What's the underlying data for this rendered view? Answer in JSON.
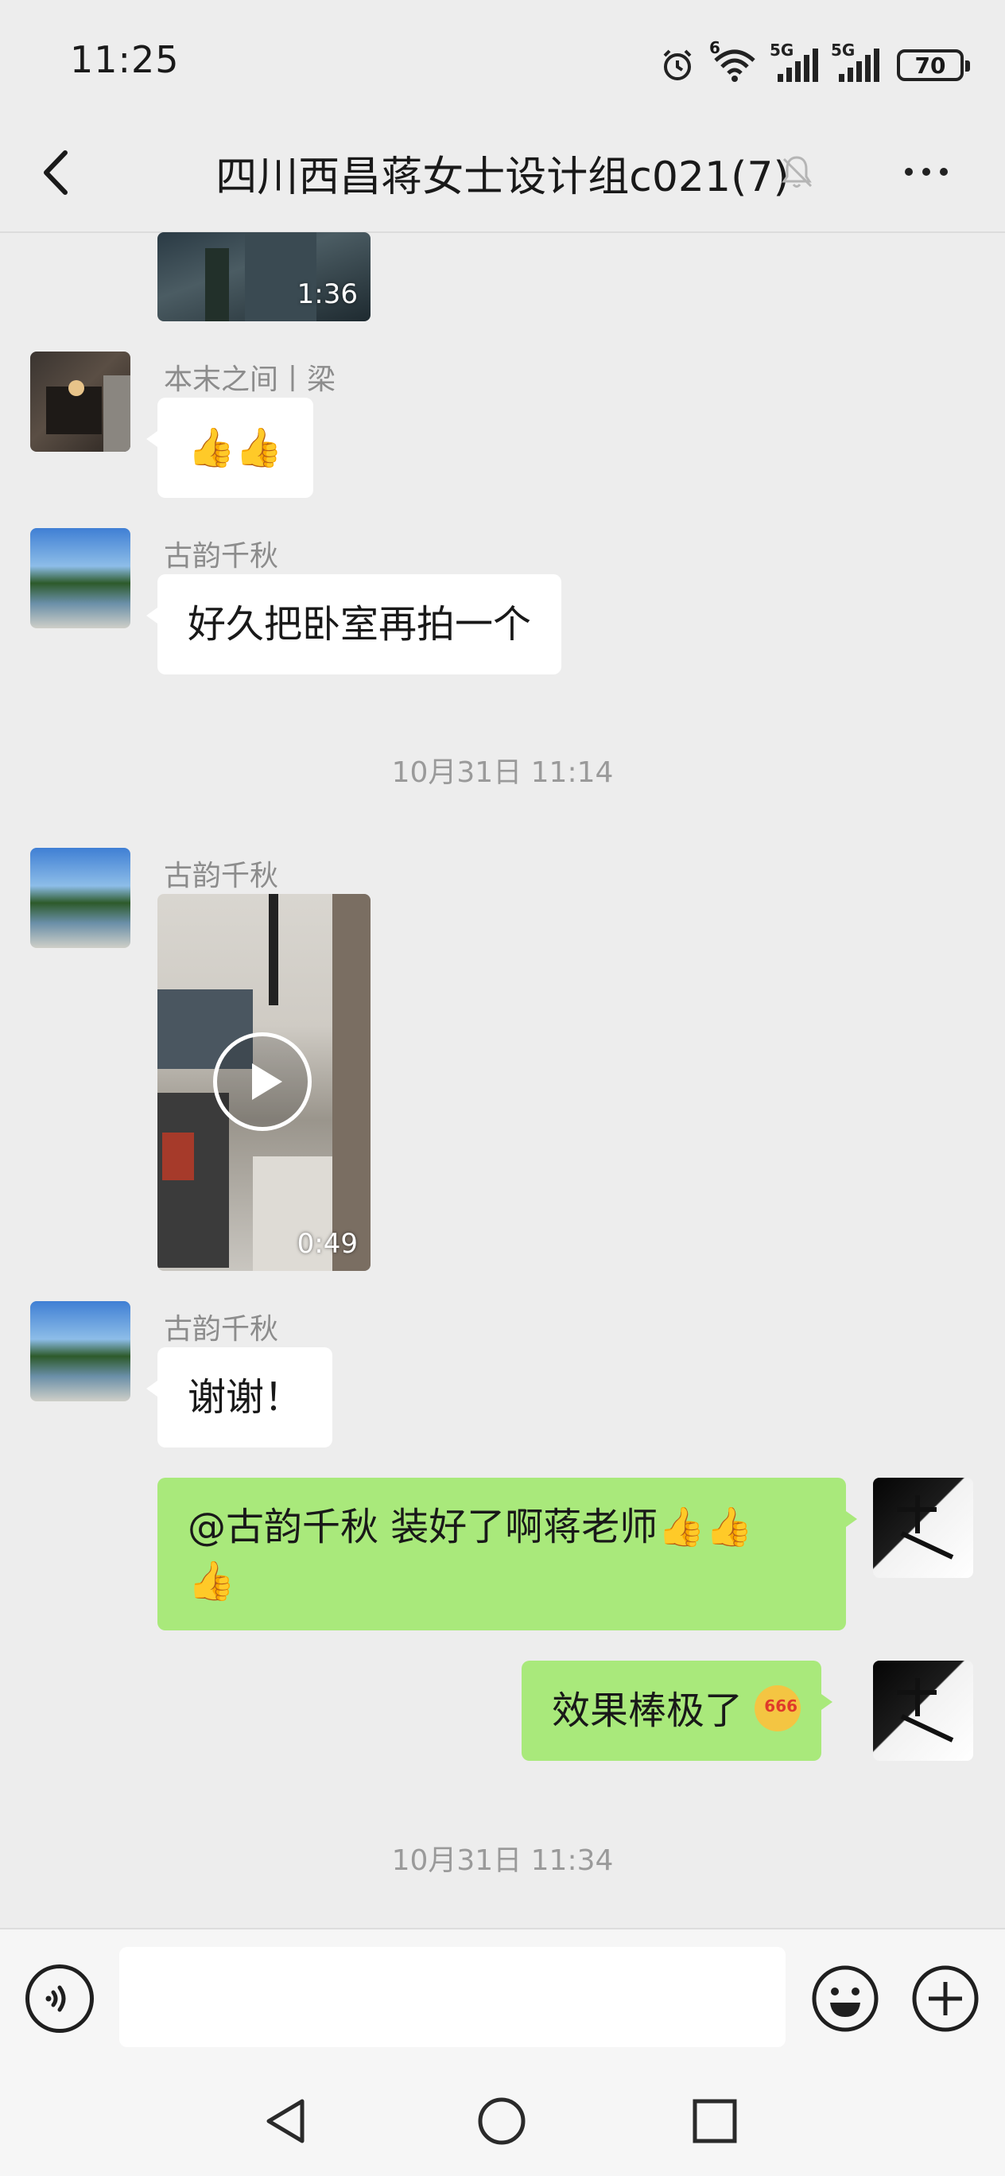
{
  "status_bar": {
    "time": "11:25",
    "battery": "70",
    "wifi_badge": "6",
    "signal1": "5G",
    "signal2": "5G"
  },
  "header": {
    "title": "四川西昌蒋女士设计组c021(7)"
  },
  "messages": {
    "video_top": {
      "duration": "1:36"
    },
    "m1": {
      "sender": "本末之间丨梁",
      "text": "👍👍"
    },
    "m2": {
      "sender": "古韵千秋",
      "text": "好久把卧室再拍一个"
    },
    "ts1": "10月31日 11:14",
    "m3": {
      "sender": "古韵千秋",
      "duration": "0:49"
    },
    "m4": {
      "sender": "古韵千秋",
      "text": "谢谢！"
    },
    "m5": {
      "line1": "@古韵千秋  装好了啊蒋老师👍👍",
      "line2": "👍"
    },
    "m6": {
      "text": "效果棒极了",
      "emoji_badge": "666"
    },
    "ts2": "10月31日 11:34"
  },
  "input": {
    "placeholder": ""
  },
  "colors": {
    "background": "#ededed",
    "sent_bubble": "#a9e97b",
    "received_bubble": "#ffffff"
  },
  "icons": [
    "back-icon",
    "mute-icon",
    "more-icon",
    "voice-icon",
    "emoji-icon",
    "plus-icon",
    "nav-back-icon",
    "nav-home-icon",
    "nav-recents-icon"
  ]
}
